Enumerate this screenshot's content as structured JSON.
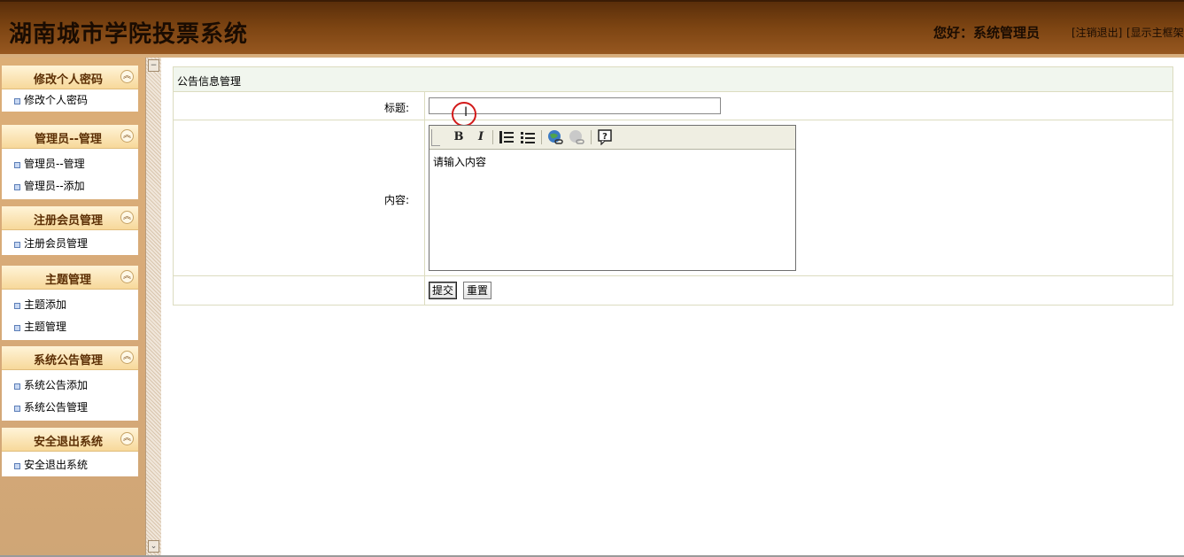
{
  "header": {
    "title": "湖南城市学院投票系统",
    "greeting": "您好：系统管理员",
    "logout_link": "[注销退出]",
    "show_frame_link": "[显示主框架"
  },
  "sidebar": {
    "panels": [
      {
        "title": "修改个人密码",
        "items": [
          "修改个人密码"
        ]
      },
      {
        "title": "管理员--管理",
        "items": [
          "管理员--管理",
          "管理员--添加"
        ]
      },
      {
        "title": "注册会员管理",
        "items": [
          "注册会员管理"
        ]
      },
      {
        "title": "主题管理",
        "items": [
          "主题添加",
          "主题管理"
        ]
      },
      {
        "title": "系统公告管理",
        "items": [
          "系统公告添加",
          "系统公告管理"
        ]
      },
      {
        "title": "安全退出系统",
        "items": [
          "安全退出系统"
        ]
      }
    ]
  },
  "form": {
    "heading": "公告信息管理",
    "title_label": "标题:",
    "title_value": "",
    "content_label": "内容:",
    "content_placeholder": "请输入内容",
    "submit_label": "提交",
    "reset_label": "重置"
  },
  "icons": {
    "collapse": "double-chevron-up-icon",
    "bullet": "square-bullet-icon",
    "toolbar": [
      "bold-icon",
      "italic-icon",
      "numbered-list-icon",
      "bulleted-list-icon",
      "insert-link-icon",
      "unlink-icon",
      "help-icon"
    ]
  }
}
